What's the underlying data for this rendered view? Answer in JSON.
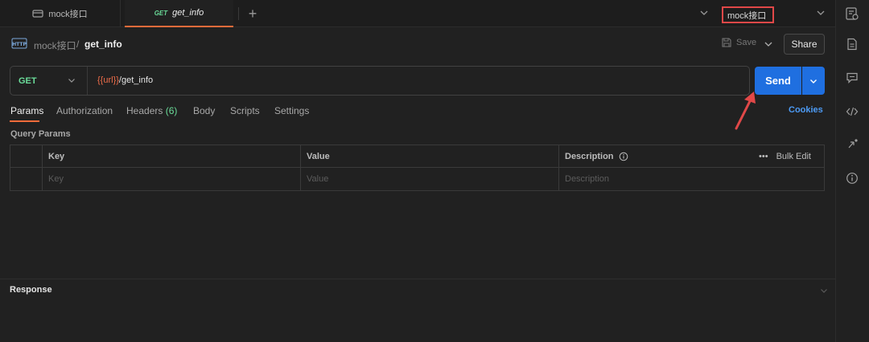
{
  "tabs": [
    {
      "label": "mock接口"
    },
    {
      "method": "GET",
      "label": "get_info"
    }
  ],
  "environment": {
    "selected": "mock接口"
  },
  "breadcrumb": {
    "parent": "mock接口",
    "separator": "/",
    "current": "get_info"
  },
  "toolbar": {
    "save_label": "Save",
    "share_label": "Share"
  },
  "request": {
    "method": "GET",
    "url_variable": "{{url}}",
    "url_path": "/get_info",
    "send_label": "Send"
  },
  "request_tabs": [
    {
      "label": "Params"
    },
    {
      "label": "Authorization"
    },
    {
      "label": "Headers",
      "count": "(6)"
    },
    {
      "label": "Body"
    },
    {
      "label": "Scripts"
    },
    {
      "label": "Settings"
    }
  ],
  "cookies_label": "Cookies",
  "query_params": {
    "title": "Query Params",
    "columns": {
      "key": "Key",
      "value": "Value",
      "description": "Description"
    },
    "bulk_edit_label": "Bulk Edit",
    "placeholders": {
      "key": "Key",
      "value": "Value",
      "description": "Description"
    }
  },
  "response": {
    "title": "Response"
  },
  "colors": {
    "accent": "#f26b3a",
    "send": "#1f6fe0",
    "method_get": "#6bdd9a",
    "variable": "#ef6d4a",
    "highlight_box": "#e14848",
    "link": "#4d9bf5"
  },
  "icons": {
    "collection": "collection-icon",
    "add": "plus-icon",
    "http": "http-icon",
    "save": "floppy-disk-icon",
    "info": "info-circle-icon",
    "more": "ellipsis-icon"
  }
}
